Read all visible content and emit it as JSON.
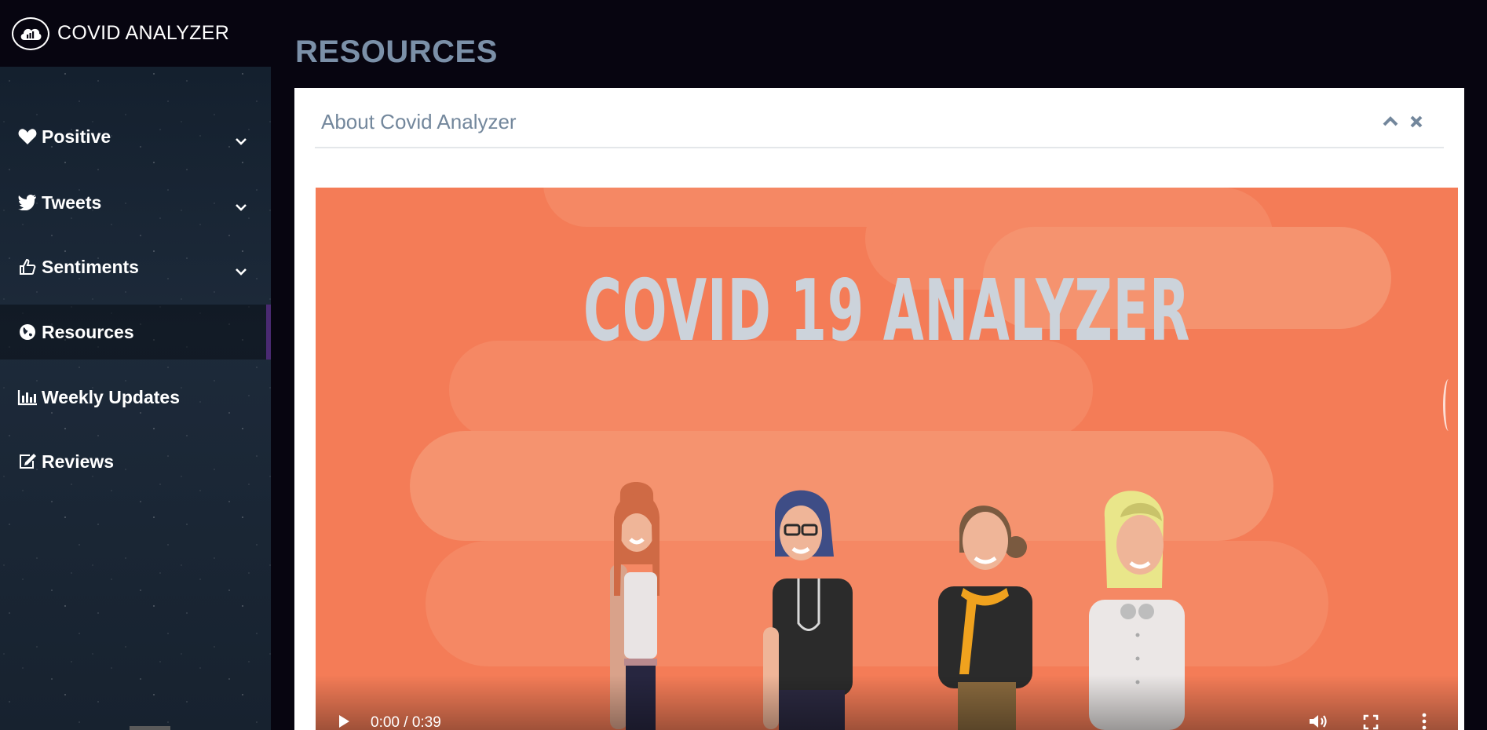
{
  "brand": {
    "title": "COVID ANALYZER",
    "logo_icon": "cloud-chart-icon"
  },
  "sidebar": {
    "items": [
      {
        "label": "Positive",
        "icon": "heart-icon",
        "has_dropdown": true
      },
      {
        "label": "Tweets",
        "icon": "twitter-icon",
        "has_dropdown": true
      },
      {
        "label": "Sentiments",
        "icon": "thumbs-up-icon",
        "has_dropdown": true
      },
      {
        "label": "Resources",
        "icon": "globe-icon",
        "has_dropdown": false,
        "active": true
      },
      {
        "label": "Weekly Updates",
        "icon": "bar-chart-icon",
        "has_dropdown": false
      },
      {
        "label": "Reviews",
        "icon": "edit-icon",
        "has_dropdown": false
      }
    ]
  },
  "page": {
    "title": "RESOURCES"
  },
  "panel": {
    "title": "About Covid Analyzer",
    "collapse_icon": "chevron-up-icon",
    "close_icon": "close-icon"
  },
  "video": {
    "heading": "COVID 19 ANALYZER",
    "time": "0:00 / 0:39",
    "progress": 0,
    "background_color": "#f47c57"
  },
  "colors": {
    "page_bg": "#070510",
    "title": "#7b90a8",
    "panel_title": "#73879c",
    "active_marker": "#4a2a72"
  }
}
